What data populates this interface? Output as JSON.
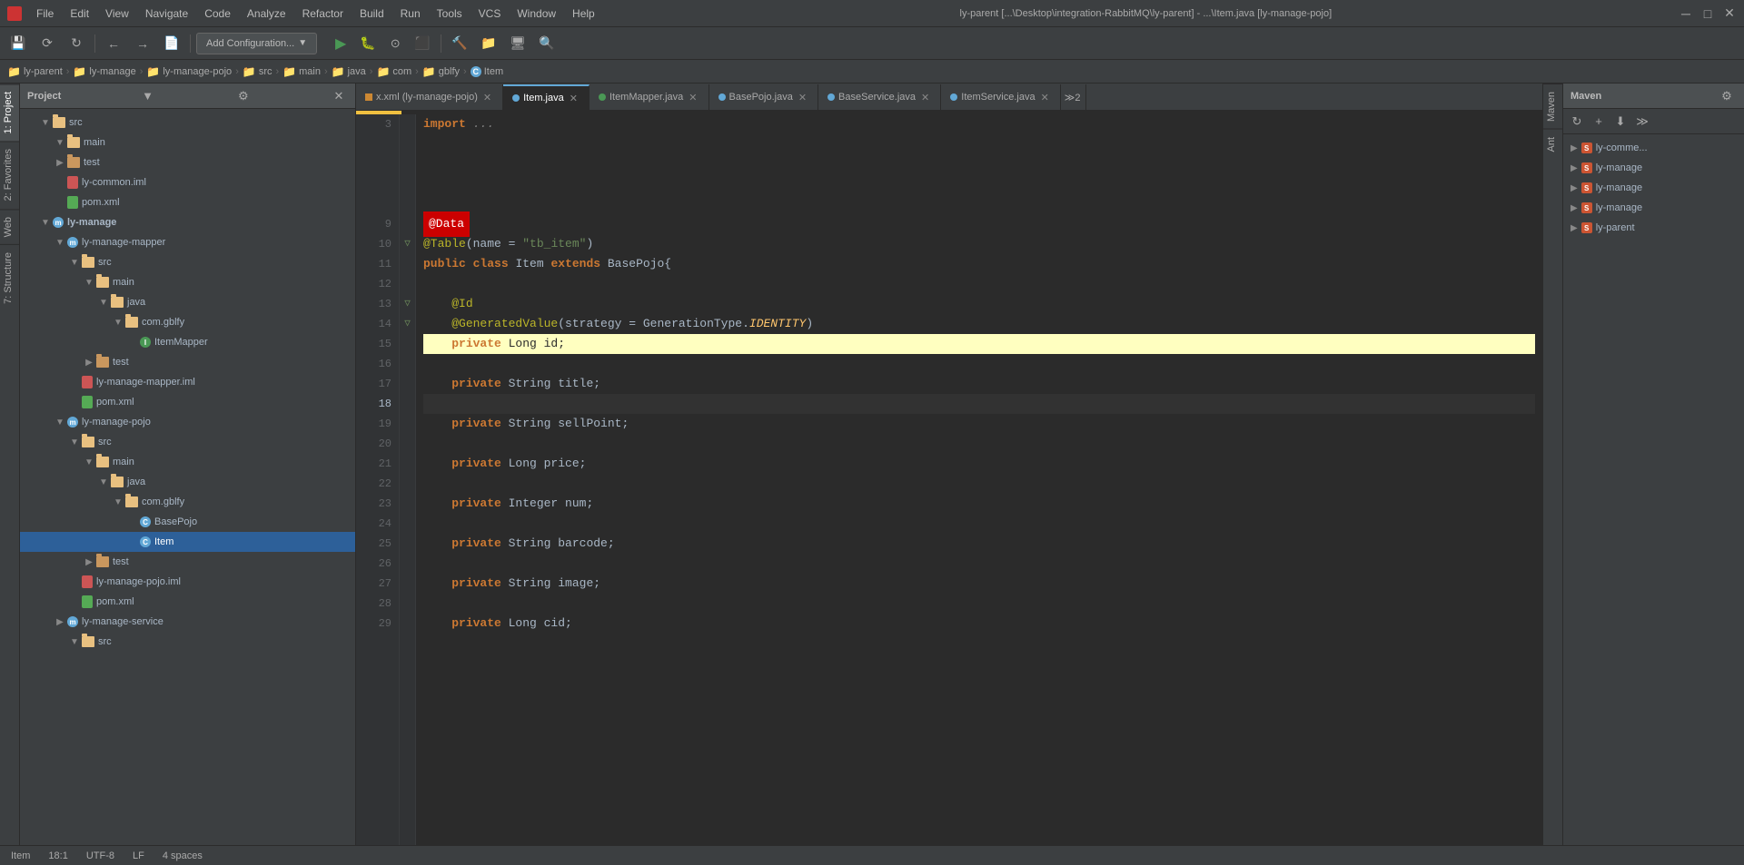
{
  "titlebar": {
    "title": "ly-parent [...\\Desktop\\integration-RabbitMQ\\ly-parent] - ...\\Item.java [ly-manage-pojo]",
    "menus": [
      "File",
      "Edit",
      "View",
      "Navigate",
      "Code",
      "Analyze",
      "Refactor",
      "Build",
      "Run",
      "Tools",
      "VCS",
      "Window",
      "Help"
    ]
  },
  "toolbar": {
    "config_btn": "Add Configuration...",
    "nav_back": "←",
    "nav_forward": "→"
  },
  "breadcrumb": {
    "items": [
      "ly-parent",
      "ly-manage",
      "ly-manage-pojo",
      "src",
      "main",
      "java",
      "com",
      "gblfy",
      "Item"
    ]
  },
  "project_panel": {
    "title": "Project",
    "tree": [
      {
        "label": "src",
        "indent": 1,
        "type": "folder",
        "expanded": true
      },
      {
        "label": "main",
        "indent": 2,
        "type": "folder",
        "expanded": true
      },
      {
        "label": "test",
        "indent": 2,
        "type": "folder",
        "collapsed": true
      },
      {
        "label": "ly-common.iml",
        "indent": 2,
        "type": "iml"
      },
      {
        "label": "pom.xml",
        "indent": 2,
        "type": "pom"
      },
      {
        "label": "ly-manage",
        "indent": 1,
        "type": "module",
        "expanded": true
      },
      {
        "label": "ly-manage-mapper",
        "indent": 2,
        "type": "module",
        "expanded": true
      },
      {
        "label": "src",
        "indent": 3,
        "type": "folder",
        "expanded": true
      },
      {
        "label": "main",
        "indent": 4,
        "type": "folder",
        "expanded": true
      },
      {
        "label": "java",
        "indent": 5,
        "type": "folder",
        "expanded": true
      },
      {
        "label": "com.gblfy",
        "indent": 6,
        "type": "folder",
        "expanded": true
      },
      {
        "label": "ItemMapper",
        "indent": 7,
        "type": "class-green"
      },
      {
        "label": "test",
        "indent": 4,
        "type": "folder",
        "collapsed": true
      },
      {
        "label": "ly-manage-mapper.iml",
        "indent": 3,
        "type": "iml"
      },
      {
        "label": "pom.xml",
        "indent": 3,
        "type": "pom"
      },
      {
        "label": "ly-manage-pojo",
        "indent": 2,
        "type": "module",
        "expanded": true
      },
      {
        "label": "src",
        "indent": 3,
        "type": "folder",
        "expanded": true
      },
      {
        "label": "main",
        "indent": 4,
        "type": "folder",
        "expanded": true
      },
      {
        "label": "java",
        "indent": 5,
        "type": "folder",
        "expanded": true
      },
      {
        "label": "com.gblfy",
        "indent": 6,
        "type": "folder",
        "expanded": true
      },
      {
        "label": "BasePojo",
        "indent": 7,
        "type": "class"
      },
      {
        "label": "Item",
        "indent": 7,
        "type": "class",
        "selected": true
      },
      {
        "label": "test",
        "indent": 4,
        "type": "folder",
        "collapsed": true
      },
      {
        "label": "ly-manage-pojo.iml",
        "indent": 3,
        "type": "iml"
      },
      {
        "label": "pom.xml",
        "indent": 3,
        "type": "pom"
      },
      {
        "label": "ly-manage-service",
        "indent": 2,
        "type": "module",
        "collapsed": true
      },
      {
        "label": "src",
        "indent": 3,
        "type": "folder"
      }
    ]
  },
  "editor_tabs": [
    {
      "label": "x.xml (ly-manage-pojo)",
      "type": "xml",
      "active": false
    },
    {
      "label": "Item.java",
      "type": "java",
      "active": true
    },
    {
      "label": "ItemMapper.java",
      "type": "java-green",
      "active": false
    },
    {
      "label": "BasePojo.java",
      "type": "java",
      "active": false
    },
    {
      "label": "BaseService.java",
      "type": "java",
      "active": false
    },
    {
      "label": "ItemService.java",
      "type": "java",
      "active": false
    }
  ],
  "code": {
    "lines": [
      {
        "num": 3,
        "content": "import ...",
        "type": "import"
      },
      {
        "num": 9,
        "content": "@Data",
        "type": "annotation-highlight"
      },
      {
        "num": 10,
        "content": "@Table(name = \"tb_item\")",
        "type": "annotation"
      },
      {
        "num": 11,
        "content": "public class Item extends BasePojo{",
        "type": "class-decl"
      },
      {
        "num": 12,
        "content": "",
        "type": "empty"
      },
      {
        "num": 13,
        "content": "    @Id",
        "type": "annotation"
      },
      {
        "num": 14,
        "content": "    @GeneratedValue(strategy = GenerationType.IDENTITY)",
        "type": "annotation"
      },
      {
        "num": 15,
        "content": "    private Long id;",
        "type": "field",
        "highlighted": true
      },
      {
        "num": 16,
        "content": "",
        "type": "empty"
      },
      {
        "num": 17,
        "content": "    private String title;",
        "type": "field"
      },
      {
        "num": 18,
        "content": "",
        "type": "empty-current"
      },
      {
        "num": 19,
        "content": "    private String sellPoint;",
        "type": "field"
      },
      {
        "num": 20,
        "content": "",
        "type": "empty"
      },
      {
        "num": 21,
        "content": "    private Long price;",
        "type": "field"
      },
      {
        "num": 22,
        "content": "",
        "type": "empty"
      },
      {
        "num": 23,
        "content": "    private Integer num;",
        "type": "field"
      },
      {
        "num": 24,
        "content": "",
        "type": "empty"
      },
      {
        "num": 25,
        "content": "    private String barcode;",
        "type": "field"
      },
      {
        "num": 26,
        "content": "",
        "type": "empty"
      },
      {
        "num": 27,
        "content": "    private String image;",
        "type": "field"
      },
      {
        "num": 28,
        "content": "",
        "type": "empty"
      },
      {
        "num": 29,
        "content": "    private Long cid;",
        "type": "field-partial"
      }
    ]
  },
  "maven_panel": {
    "title": "Maven",
    "items": [
      {
        "label": "ly-comme...",
        "indent": 0
      },
      {
        "label": "ly-manage",
        "indent": 0
      },
      {
        "label": "ly-manage",
        "indent": 0
      },
      {
        "label": "ly-manage",
        "indent": 0
      },
      {
        "label": "ly-parent",
        "indent": 0
      }
    ]
  },
  "status_bar": {
    "file_label": "Item",
    "position": "18:1",
    "encoding": "UTF-8",
    "line_sep": "LF",
    "indent": "4 spaces"
  },
  "side_tabs": {
    "left": [
      "1: Project",
      "2: Favorites",
      "Web",
      "7: Structure"
    ],
    "right": [
      "Maven",
      "Ant"
    ]
  }
}
